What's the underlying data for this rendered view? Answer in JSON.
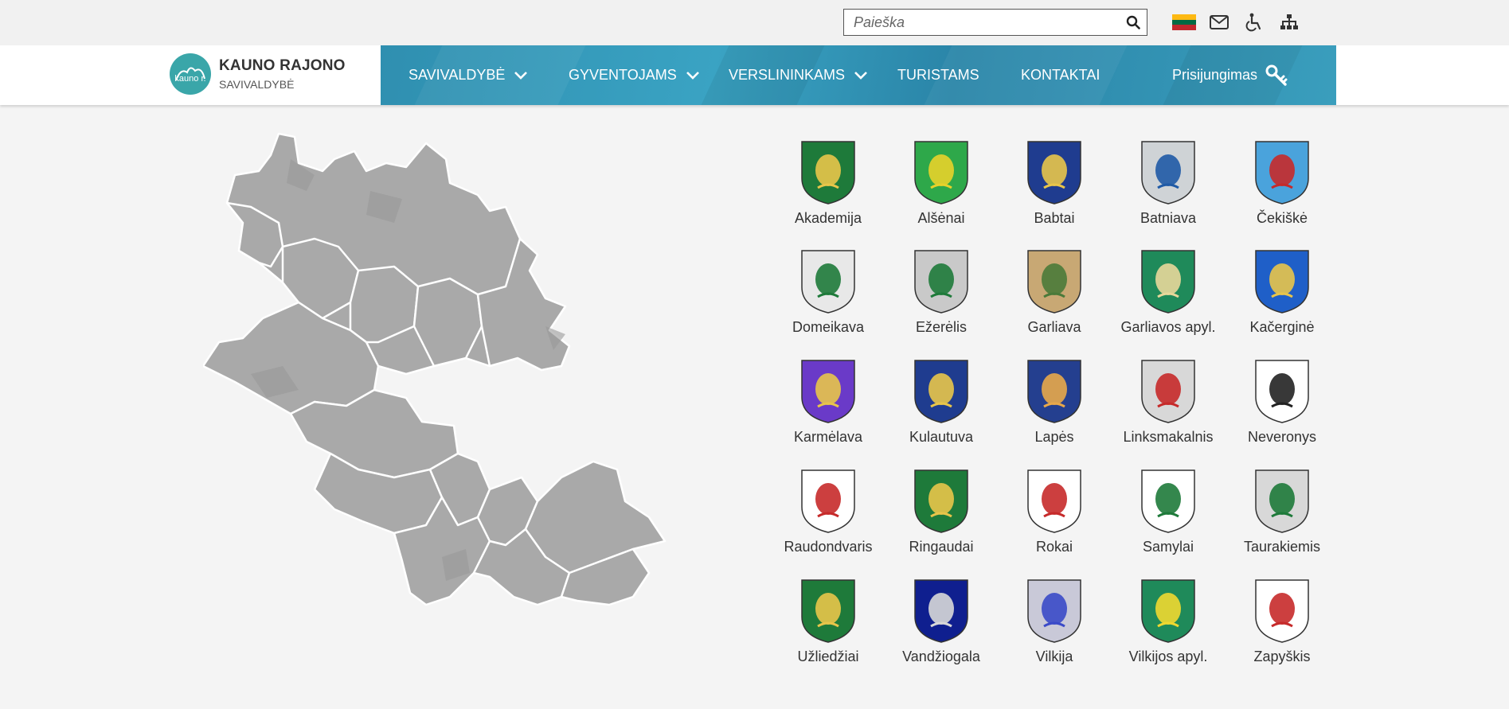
{
  "search": {
    "placeholder": "Paieška"
  },
  "utility": {
    "icons": [
      "lithuanian-flag-icon",
      "mail-icon",
      "accessibility-icon",
      "sitemap-icon"
    ],
    "flag_colors": [
      "#fdb913",
      "#006a44",
      "#c1272d"
    ]
  },
  "logo": {
    "title": "KAUNO RAJONO",
    "subtitle": "SAVIVALDYBĖ",
    "mark": "kauno r."
  },
  "nav": {
    "items": [
      {
        "label": "SAVIVALDYBĖ",
        "dropdown": true
      },
      {
        "label": "GYVENTOJAMS",
        "dropdown": true
      },
      {
        "label": "VERSLININKAMS",
        "dropdown": true
      },
      {
        "label": "TURISTAMS",
        "dropdown": false
      },
      {
        "label": "KONTAKTAI",
        "dropdown": false
      },
      {
        "label": "Prisijungimas",
        "dropdown": false
      }
    ]
  },
  "colors": {
    "accent": "#3399b9",
    "map_fill": "#a8a8a8",
    "map_border": "#ffffff"
  },
  "coats": [
    {
      "name": "Akademija",
      "bg": "#1e7a3a",
      "fg": "#e8c54a"
    },
    {
      "name": "Alšėnai",
      "bg": "#2ea84a",
      "fg": "#e8d12a"
    },
    {
      "name": "Babtai",
      "bg": "#1f3c8f",
      "fg": "#e8c54a"
    },
    {
      "name": "Batniava",
      "bg": "#cfd3d6",
      "fg": "#1f5aa6"
    },
    {
      "name": "Čekiškė",
      "bg": "#4aa3dc",
      "fg": "#c62a2a"
    },
    {
      "name": "Domeikava",
      "bg": "#e8e8e8",
      "fg": "#1e7a3a"
    },
    {
      "name": "Ežerėlis",
      "bg": "#c9c9c9",
      "fg": "#1e7a3a"
    },
    {
      "name": "Garliava",
      "bg": "#c8a874",
      "fg": "#4a7a3a"
    },
    {
      "name": "Garliavos apyl.",
      "bg": "#1f8a5a",
      "fg": "#e8d79a"
    },
    {
      "name": "Kačerginė",
      "bg": "#1f5fc8",
      "fg": "#e8c54a"
    },
    {
      "name": "Karmėlava",
      "bg": "#6a3ac8",
      "fg": "#e8c54a"
    },
    {
      "name": "Kulautuva",
      "bg": "#1f3c8f",
      "fg": "#e8c54a"
    },
    {
      "name": "Lapės",
      "bg": "#243f8f",
      "fg": "#e8a84a"
    },
    {
      "name": "Linksmakalnis",
      "bg": "#d8d8d8",
      "fg": "#c62a2a"
    },
    {
      "name": "Neveronys",
      "bg": "#ffffff",
      "fg": "#222222"
    },
    {
      "name": "Raudondvaris",
      "bg": "#ffffff",
      "fg": "#c62a2a"
    },
    {
      "name": "Ringaudai",
      "bg": "#1e7a3a",
      "fg": "#e8c54a"
    },
    {
      "name": "Rokai",
      "bg": "#ffffff",
      "fg": "#c62a2a"
    },
    {
      "name": "Samylai",
      "bg": "#ffffff",
      "fg": "#1e7a3a"
    },
    {
      "name": "Taurakiemis",
      "bg": "#d8d8d8",
      "fg": "#1e7a3a"
    },
    {
      "name": "Užliedžiai",
      "bg": "#1e7a3a",
      "fg": "#e8c54a"
    },
    {
      "name": "Vandžiogala",
      "bg": "#0f1f8f",
      "fg": "#d8d8d8"
    },
    {
      "name": "Vilkija",
      "bg": "#c9c9d8",
      "fg": "#3a4ac8"
    },
    {
      "name": "Vilkijos apyl.",
      "bg": "#1f8a5a",
      "fg": "#f0d830"
    },
    {
      "name": "Zapyškis",
      "bg": "#ffffff",
      "fg": "#c62a2a"
    }
  ]
}
